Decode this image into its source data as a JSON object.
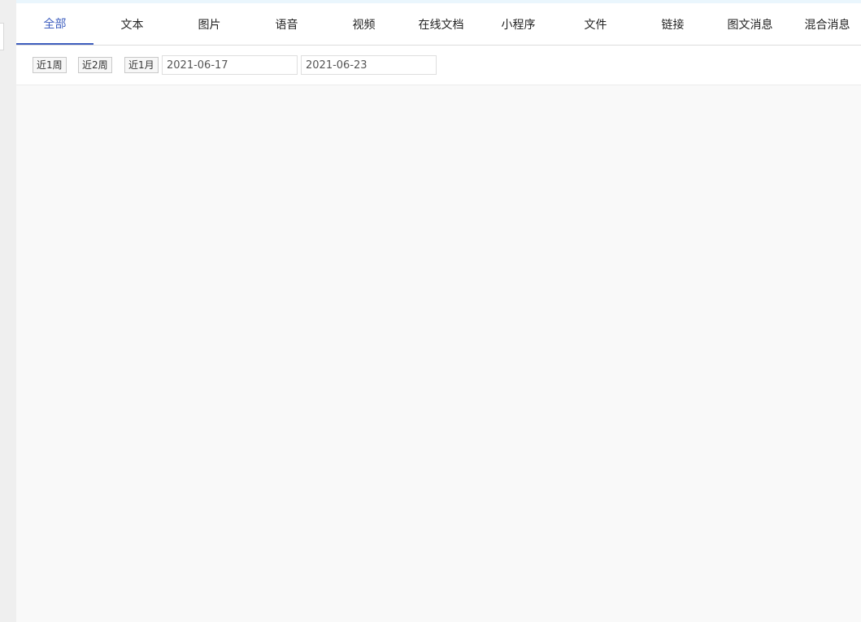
{
  "tabs": [
    {
      "label": "全部",
      "active": true
    },
    {
      "label": "文本",
      "active": false
    },
    {
      "label": "图片",
      "active": false
    },
    {
      "label": "语音",
      "active": false
    },
    {
      "label": "视频",
      "active": false
    },
    {
      "label": "在线文档",
      "active": false
    },
    {
      "label": "小程序",
      "active": false
    },
    {
      "label": "文件",
      "active": false
    },
    {
      "label": "链接",
      "active": false
    },
    {
      "label": "图文消息",
      "active": false
    },
    {
      "label": "混合消息",
      "active": false
    }
  ],
  "filters": {
    "quick_ranges": [
      "近1周",
      "近2周",
      "近1月"
    ],
    "start_date": "2021-06-17",
    "end_date": "2021-06-23"
  },
  "colors": {
    "accent": "#3f5fbf",
    "top_band": "#eaf6fd",
    "content_bg": "#f9f9f9"
  }
}
